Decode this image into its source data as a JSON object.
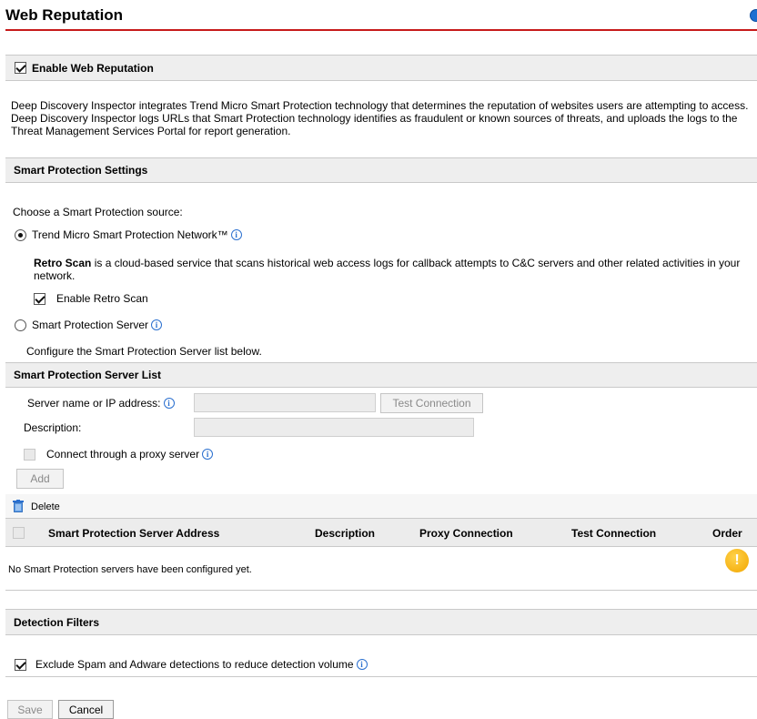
{
  "page": {
    "title": "Web Reputation"
  },
  "enable_section": {
    "label": "Enable Web Reputation",
    "checked": true,
    "description": "Deep Discovery Inspector integrates Trend Micro Smart Protection technology that determines the reputation of websites users are attempting to access. Deep Discovery Inspector logs URLs that Smart Protection technology identifies as fraudulent or known sources of threats, and uploads the logs to the Threat Management Services Portal for report generation."
  },
  "smart_protection_settings": {
    "header": "Smart Protection Settings",
    "choose_label": "Choose a Smart Protection source:",
    "option_network": {
      "label": "Trend Micro Smart Protection Network™",
      "selected": true
    },
    "retro_scan": {
      "bold": "Retro Scan",
      "text": " is a cloud-based service that scans historical web access logs for callback attempts to C&C servers and other related activities in your network.",
      "checkbox_label": "Enable Retro Scan",
      "checked": true
    },
    "option_server": {
      "label": "Smart Protection Server",
      "selected": false
    },
    "server_note": "Configure the Smart Protection Server list below."
  },
  "server_list": {
    "header": "Smart Protection Server List",
    "server_label": "Server name or IP address:",
    "server_value": "",
    "test_connection_button": "Test Connection",
    "description_label": "Description:",
    "description_value": "",
    "proxy_label": "Connect through a proxy server",
    "proxy_checked": false,
    "add_button": "Add",
    "delete_label": "Delete",
    "columns": [
      "Smart Protection Server Address",
      "Description",
      "Proxy Connection",
      "Test Connection",
      "Order"
    ],
    "empty_message": "No Smart Protection servers have been configured yet.",
    "warning_glyph": "!"
  },
  "detection_filters": {
    "header": "Detection Filters",
    "exclude_label": "Exclude Spam and Adware detections to reduce detection volume",
    "exclude_checked": true
  },
  "footer": {
    "save_button": "Save",
    "cancel_button": "Cancel"
  },
  "colors": {
    "title_rule": "#c71a1a",
    "info_icon": "#2a6fcf",
    "warning": "#f2a600"
  }
}
